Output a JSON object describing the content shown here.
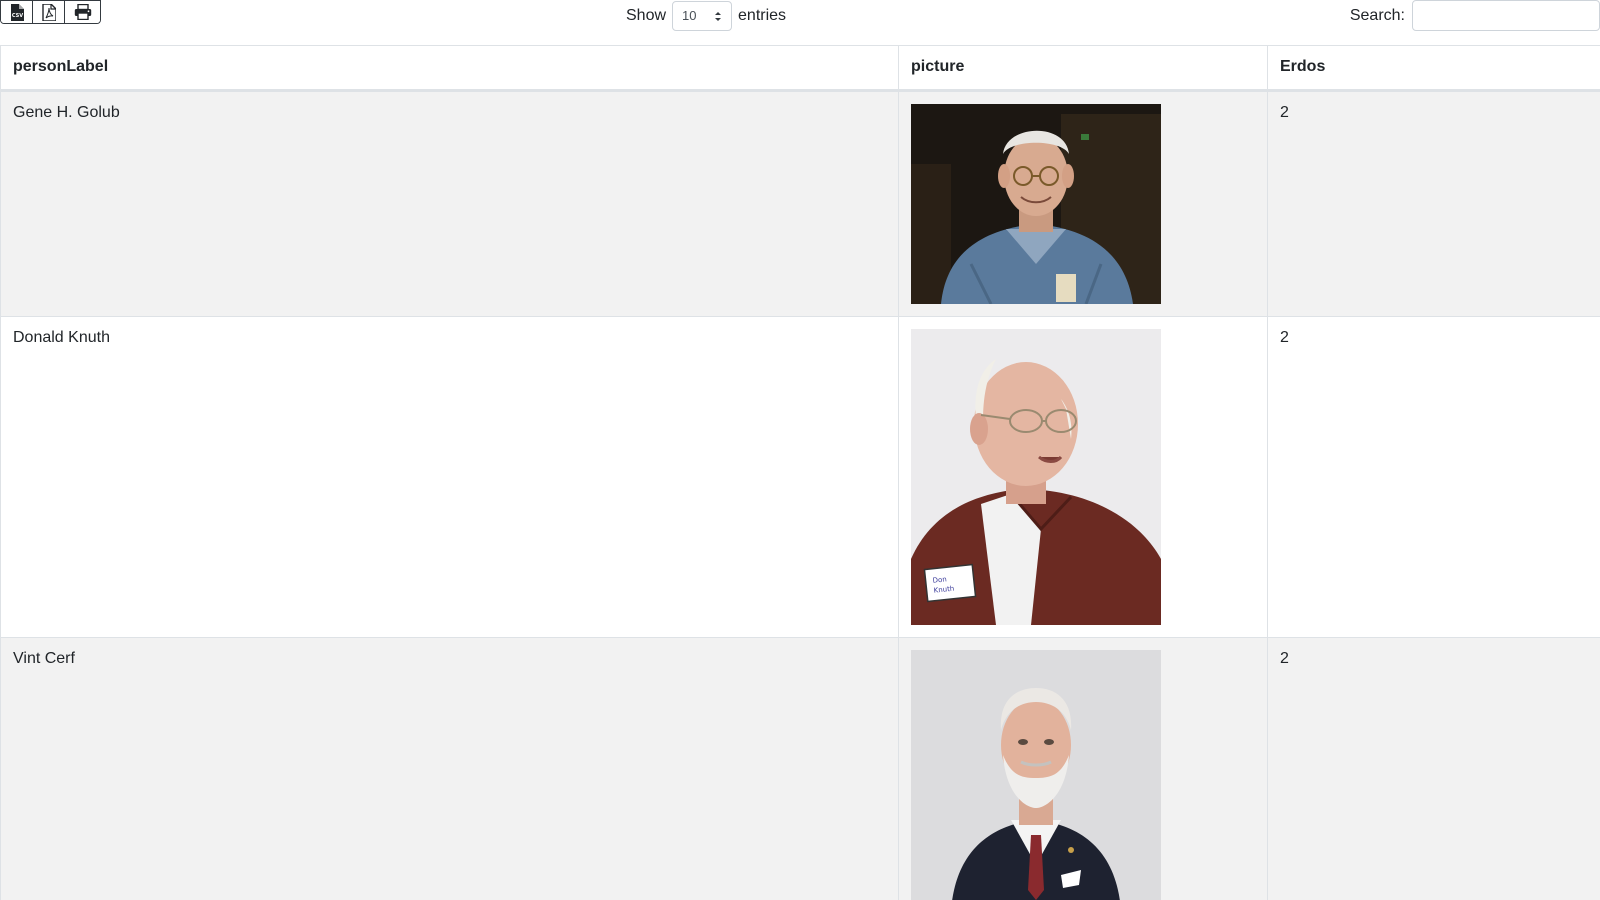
{
  "toolbar": {
    "export_buttons": [
      {
        "name": "csv-export-icon",
        "label": "CSV"
      },
      {
        "name": "pdf-export-icon",
        "label": "PDF"
      },
      {
        "name": "print-icon",
        "label": "Print"
      }
    ],
    "show_label": "Show",
    "page_length_value": "10",
    "entries_label": "entries",
    "search_label": "Search:",
    "search_value": ""
  },
  "table": {
    "columns": [
      "personLabel",
      "picture",
      "Erdos"
    ],
    "rows": [
      {
        "personLabel": "Gene H. Golub",
        "picture": "portrait-photo-gene-golub",
        "Erdos": "2"
      },
      {
        "personLabel": "Donald Knuth",
        "picture": "portrait-photo-donald-knuth",
        "Erdos": "2"
      },
      {
        "personLabel": "Vint Cerf",
        "picture": "portrait-photo-vint-cerf",
        "Erdos": "2"
      }
    ]
  },
  "colors": {
    "stripe": "#f2f2f2",
    "border": "#dee2e6",
    "text": "#212529"
  }
}
